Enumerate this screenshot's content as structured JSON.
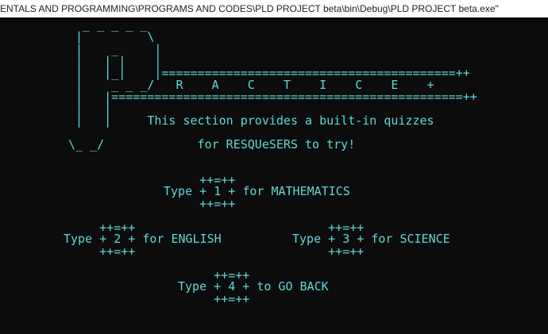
{
  "window": {
    "title": "ENTALS AND PROGRAMMING\\PROGRAMS AND CODES\\PLD PROJECT beta\\bin\\Debug\\PLD PROJECT beta.exe\""
  },
  "console": {
    "banner": [
      "  _ _ _ _ _",
      " |         \\",
      " |    _     |",
      " |   | |    |",
      " |   |_|    |=========================================++",
      " |    _ _ _/   R    A    C    T    I    C    E    +",
      " |   |=================================================++",
      " |   |",
      " |   |     This section provides a built-in quizzes",
      "",
      "\\_ _/             for RESQUeSERS to try!"
    ],
    "math_option": [
      "     ++=++",
      "Type + 1 + for MATHEMATICS",
      "     ++=++"
    ],
    "english_option": [
      "     ++=++",
      "Type + 2 + for ENGLISH",
      "     ++=++"
    ],
    "science_option": [
      "     ++=++",
      "Type + 3 + for SCIENCE",
      "     ++=++"
    ],
    "back_option": [
      "     ++=++",
      "Type + 4 + to GO BACK",
      "     ++=++"
    ]
  }
}
